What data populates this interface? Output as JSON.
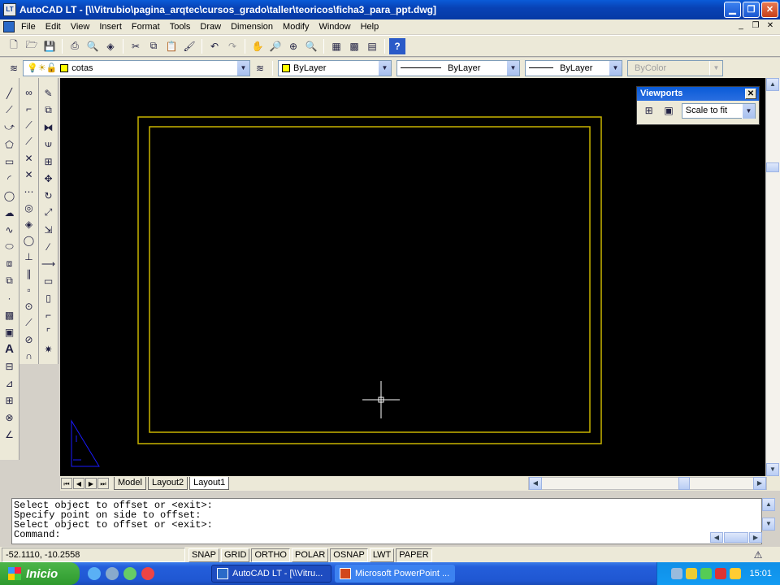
{
  "window": {
    "title": "AutoCAD LT - [\\\\Vitrubio\\pagina_arqtec\\cursos_grado\\taller\\teoricos\\ficha3_para_ppt.dwg]",
    "app_icon_text": "LT"
  },
  "menu": {
    "items": [
      "File",
      "Edit",
      "View",
      "Insert",
      "Format",
      "Tools",
      "Draw",
      "Dimension",
      "Modify",
      "Window",
      "Help"
    ]
  },
  "layers": {
    "current_layer": "cotas"
  },
  "properties": {
    "color": "ByLayer",
    "linetype": "ByLayer",
    "lineweight": "ByLayer",
    "plotstyle": "ByColor"
  },
  "viewports_panel": {
    "title": "Viewports",
    "scale": "Scale to fit"
  },
  "layout_tabs": [
    "Model",
    "Layout2",
    "Layout1"
  ],
  "active_tab": "Layout1",
  "command": {
    "history": [
      "Select object to offset or <exit>:",
      "Specify point on side to offset:",
      "Select object to offset or <exit>:"
    ],
    "prompt": "Command:"
  },
  "status": {
    "coordinates": "-52.1110, -10.2558",
    "toggles": [
      "SNAP",
      "GRID",
      "ORTHO",
      "POLAR",
      "OSNAP",
      "LWT",
      "PAPER"
    ]
  },
  "taskbar": {
    "start_label": "Inicio",
    "tasks": [
      "AutoCAD LT - [\\\\Vitru...",
      "Microsoft PowerPoint ..."
    ],
    "clock": "15:01"
  },
  "colors": {
    "canvas": "#000000",
    "paper_border": "#c8b400",
    "ucs_icon": "#1a1aff"
  }
}
